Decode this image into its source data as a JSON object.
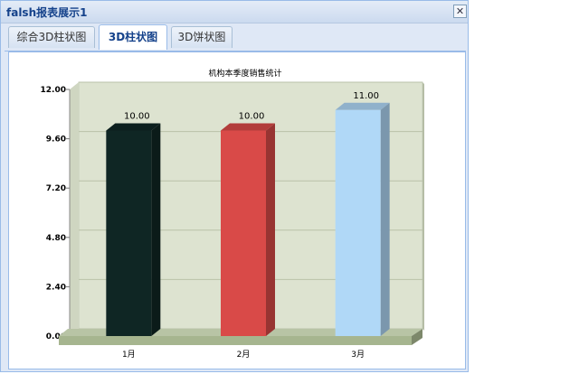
{
  "window": {
    "title": "falsh报表展示1",
    "close_symbol": "✕"
  },
  "tabs": [
    {
      "label": "综合3D柱状图",
      "active": false
    },
    {
      "label": "3D柱状图",
      "active": true
    },
    {
      "label": "3D饼状图",
      "active": false
    }
  ],
  "chart_data": {
    "type": "bar",
    "title": "机构本季度销售统计",
    "xlabel": "",
    "ylabel": "",
    "categories": [
      "1月",
      "2月",
      "3月"
    ],
    "values": [
      10,
      10,
      11
    ],
    "value_labels": [
      "10.00",
      "10.00",
      "11.00"
    ],
    "ylim": [
      0,
      12
    ],
    "yticks": [
      "0.00",
      "2.40",
      "4.80",
      "7.20",
      "9.60",
      "12.00"
    ],
    "grid": true,
    "three_d": true,
    "colors": [
      "#0f2624",
      "#d94a48",
      "#b0d8f7"
    ],
    "plot_background": "#dde3d0",
    "floor_color": "#a6b58f"
  }
}
